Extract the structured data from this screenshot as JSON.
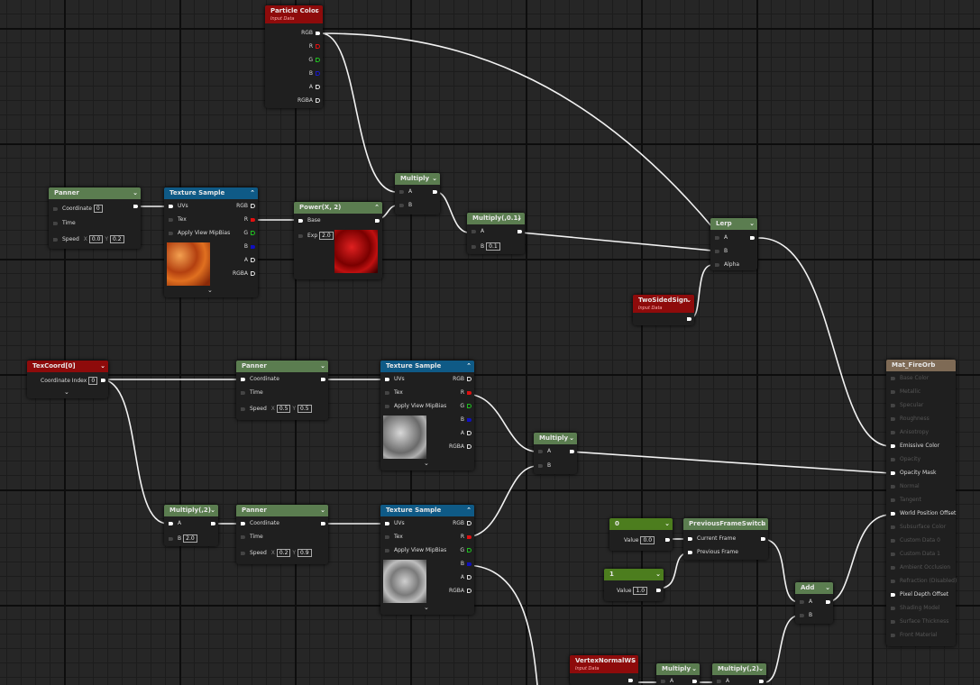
{
  "nodes": {
    "particle_color": {
      "title": "Particle Color",
      "subtitle": "Input Data",
      "outputs": [
        "RGB",
        "R",
        "G",
        "B",
        "A",
        "RGBA"
      ]
    },
    "panner1": {
      "title": "Panner",
      "inputs": [
        "Coordinate",
        "Time",
        "Speed"
      ],
      "coordinate": "0",
      "speed_x": "0.0",
      "speed_y": "0.2"
    },
    "tex1": {
      "title": "Texture Sample",
      "inputs": [
        "UVs",
        "Tex",
        "Apply View MipBias"
      ],
      "outputs": [
        "RGB",
        "R",
        "G",
        "B",
        "A",
        "RGBA"
      ]
    },
    "power": {
      "title": "Power(X, 2)",
      "inputs": [
        "Base",
        "Exp"
      ],
      "exp": "2.0"
    },
    "multiply1": {
      "title": "Multiply",
      "inputs": [
        "A",
        "B"
      ]
    },
    "multiply01": {
      "title": "Multiply(,0.1)",
      "inputs": [
        "A",
        "B"
      ],
      "b": "0.1"
    },
    "lerp": {
      "title": "Lerp",
      "inputs": [
        "A",
        "B",
        "Alpha"
      ]
    },
    "twosided": {
      "title": "TwoSidedSign",
      "subtitle": "Input Data"
    },
    "texcoord": {
      "title": "TexCoord[0]",
      "input": "Coordinate Index",
      "index": "0"
    },
    "panner2": {
      "title": "Panner",
      "inputs": [
        "Coordinate",
        "Time",
        "Speed"
      ],
      "speed_x": "0.5",
      "speed_y": "0.5"
    },
    "tex2": {
      "title": "Texture Sample",
      "inputs": [
        "UVs",
        "Tex",
        "Apply View MipBias"
      ],
      "outputs": [
        "RGB",
        "R",
        "G",
        "B",
        "A",
        "RGBA"
      ]
    },
    "multiply2": {
      "title": "Multiply",
      "inputs": [
        "A",
        "B"
      ]
    },
    "multiply_2": {
      "title": "Multiply(,2)",
      "inputs": [
        "A",
        "B"
      ],
      "b": "2.0"
    },
    "panner3": {
      "title": "Panner",
      "inputs": [
        "Coordinate",
        "Time",
        "Speed"
      ],
      "speed_x": "0.2",
      "speed_y": "0.9"
    },
    "tex3": {
      "title": "Texture Sample",
      "inputs": [
        "UVs",
        "Tex",
        "Apply View MipBias"
      ],
      "outputs": [
        "RGB",
        "R",
        "G",
        "B",
        "A",
        "RGBA"
      ]
    },
    "const0": {
      "title": "0",
      "label": "Value",
      "value": "0.0"
    },
    "const1": {
      "title": "1",
      "label": "Value",
      "value": "1.0"
    },
    "pfs": {
      "title": "PreviousFrameSwitch",
      "inputs": [
        "Current Frame",
        "Previous Frame"
      ]
    },
    "add": {
      "title": "Add",
      "inputs": [
        "A",
        "B"
      ]
    },
    "vertexnormal": {
      "title": "VertexNormalWS",
      "subtitle": "Input Data"
    },
    "multiply3": {
      "title": "Multiply",
      "inputs": [
        "A"
      ]
    },
    "multiply_2b": {
      "title": "Multiply(,2)",
      "inputs": [
        "A"
      ]
    },
    "material": {
      "title": "Mat_FireOrb",
      "pins": [
        "Base Color",
        "Metallic",
        "Specular",
        "Roughness",
        "Anisotropy",
        "Emissive Color",
        "Opacity",
        "Opacity Mask",
        "Normal",
        "Tangent",
        "World Position Offset",
        "Subsurface Color",
        "Custom Data 0",
        "Custom Data 1",
        "Ambient Occlusion",
        "Refraction (Disabled)",
        "Pixel Depth Offset",
        "Shading Model",
        "Surface Thickness",
        "Front Material"
      ]
    }
  },
  "labels": {
    "x": "X",
    "y": "Y"
  },
  "colors": {
    "graph_bg": "#262626",
    "wire": "#ffffff",
    "header_green": "#5b7d50",
    "header_blue": "#0f5a86",
    "header_red": "#8e0b0b",
    "header_result": "#7e6a55"
  }
}
